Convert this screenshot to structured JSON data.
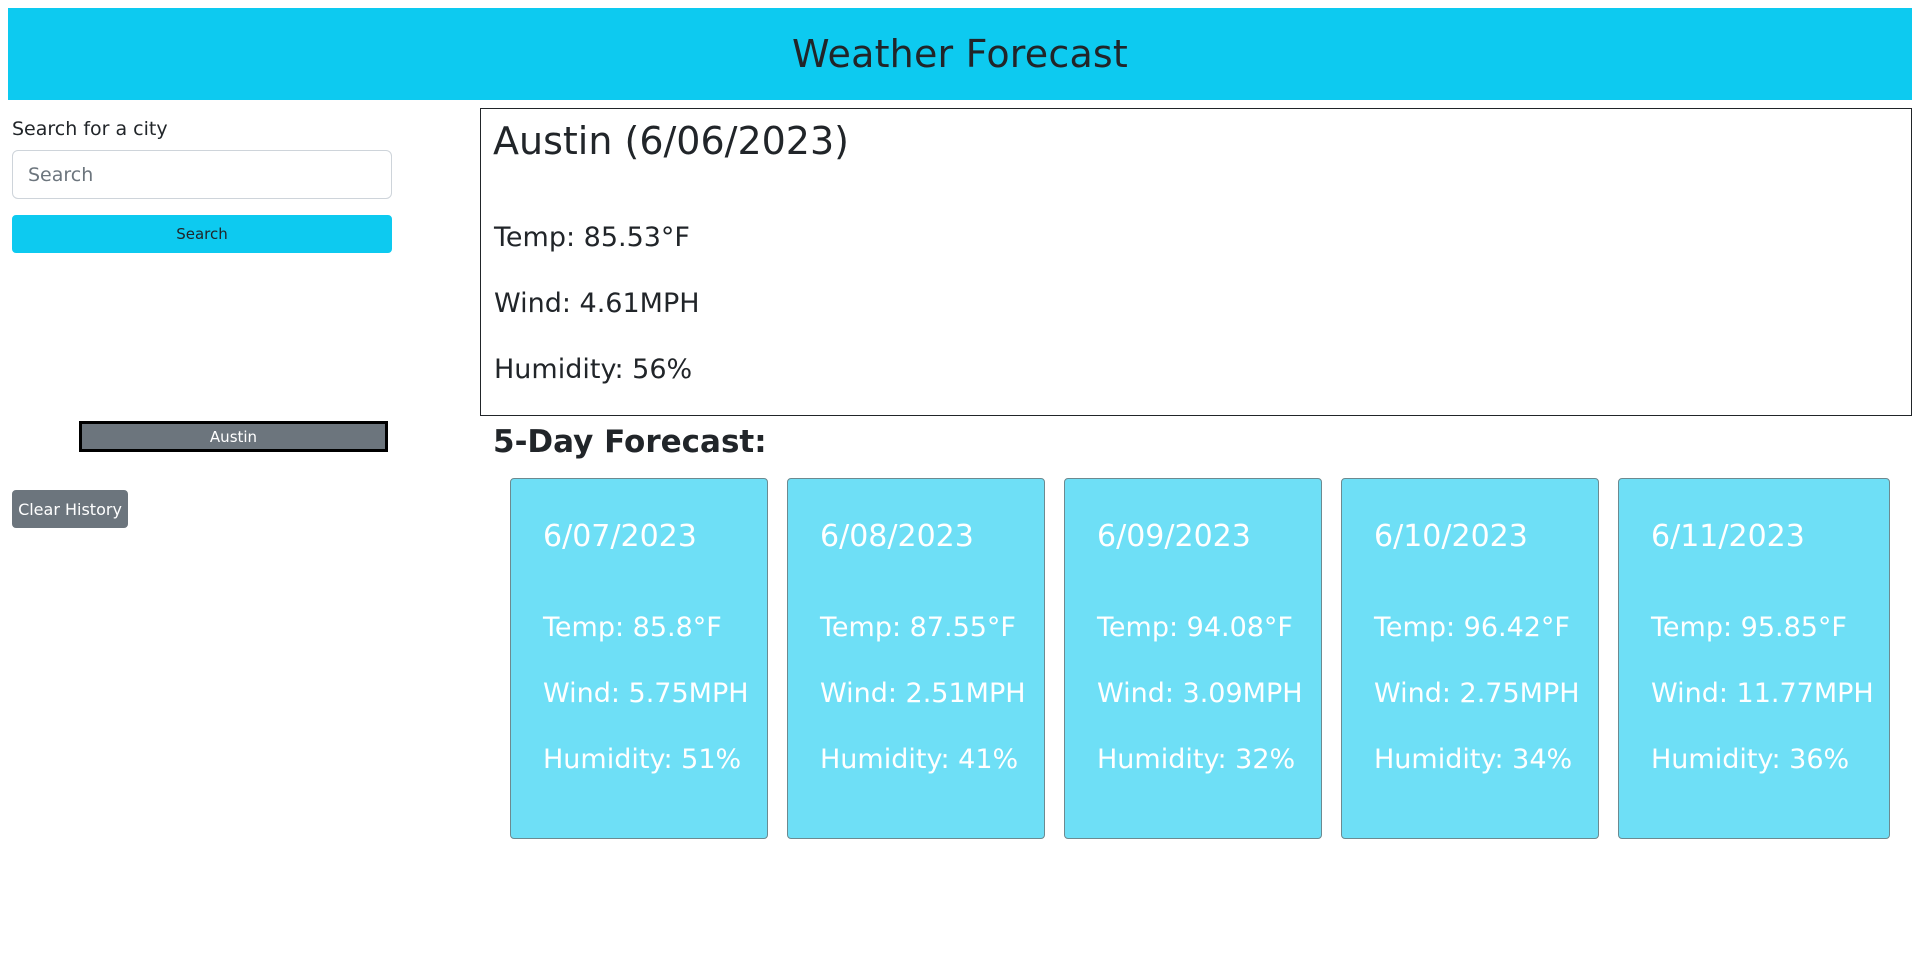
{
  "header": {
    "title": "Weather Forecast"
  },
  "sidebar": {
    "search_label": "Search for a city",
    "search_placeholder": "Search",
    "search_value": "",
    "search_button": "Search",
    "history": [
      "Austin"
    ],
    "clear_button": "Clear History"
  },
  "current": {
    "title": "Austin (6/06/2023)",
    "temp": "Temp: 85.53°F",
    "wind": "Wind: 4.61MPH",
    "humidity": "Humidity: 56%"
  },
  "forecast": {
    "title": "5-Day Forecast:",
    "days": [
      {
        "date": "6/07/2023",
        "temp": "Temp: 85.8°F",
        "wind": "Wind: 5.75MPH",
        "humidity": "Humidity: 51%"
      },
      {
        "date": "6/08/2023",
        "temp": "Temp: 87.55°F",
        "wind": "Wind: 2.51MPH",
        "humidity": "Humidity: 41%"
      },
      {
        "date": "6/09/2023",
        "temp": "Temp: 94.08°F",
        "wind": "Wind: 3.09MPH",
        "humidity": "Humidity: 32%"
      },
      {
        "date": "6/10/2023",
        "temp": "Temp: 96.42°F",
        "wind": "Wind: 2.75MPH",
        "humidity": "Humidity: 34%"
      },
      {
        "date": "6/11/2023",
        "temp": "Temp: 95.85°F",
        "wind": "Wind: 11.77MPH",
        "humidity": "Humidity: 36%"
      }
    ]
  },
  "colors": {
    "header_bg": "#0dcaf0",
    "card_bg": "#6edff6",
    "history_button_bg": "#6c757d"
  }
}
